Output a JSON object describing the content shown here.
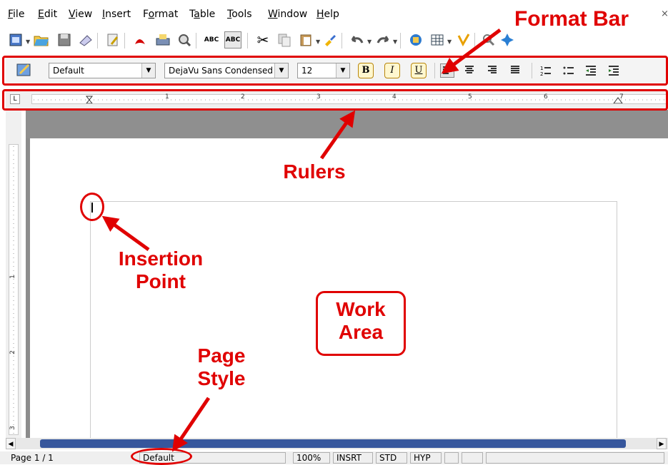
{
  "menu": {
    "items": [
      {
        "label": "File"
      },
      {
        "label": "Edit"
      },
      {
        "label": "View"
      },
      {
        "label": "Insert"
      },
      {
        "label": "Format"
      },
      {
        "label": "Table"
      },
      {
        "label": "Tools"
      },
      {
        "label": "Window"
      },
      {
        "label": "Help"
      }
    ],
    "close_glyph": "×"
  },
  "toolbar": {
    "icons": [
      "new-document-icon",
      "open-folder-icon",
      "save-icon",
      "email-icon",
      "edit-file-icon",
      "export-pdf-icon",
      "print-icon",
      "print-preview-icon",
      "spellcheck-icon",
      "autospellcheck-icon",
      "cut-icon",
      "copy-icon",
      "paste-icon",
      "format-paintbrush-icon",
      "undo-icon",
      "redo-icon",
      "navigator-icon",
      "table-icon",
      "highlighter-icon",
      "find-icon",
      "star-icon"
    ],
    "spellcheck_label": "ABC",
    "autospell_label": "ABC"
  },
  "format": {
    "style_value": "Default",
    "font_value": "DejaVu Sans Condensed",
    "size_value": "12",
    "bold_label": "B",
    "italic_label": "I",
    "underline_label": "U"
  },
  "ruler": {
    "numbers": [
      "1",
      "2",
      "3",
      "4",
      "5",
      "6",
      "7"
    ],
    "tab_glyph": "L"
  },
  "vruler": {
    "numbers": [
      "1",
      "2",
      "3"
    ]
  },
  "statusbar": {
    "page": "Page 1 / 1",
    "page_style": "Default",
    "zoom": "100%",
    "insert_mode": "INSRT",
    "selection_mode": "STD",
    "hyphen": "HYP"
  },
  "annotations": {
    "format_bar": "Format Bar",
    "rulers": "Rulers",
    "insertion_point": "Insertion Point",
    "work_area": "Work Area",
    "page_style": "Page Style",
    "color": "#e00000"
  }
}
